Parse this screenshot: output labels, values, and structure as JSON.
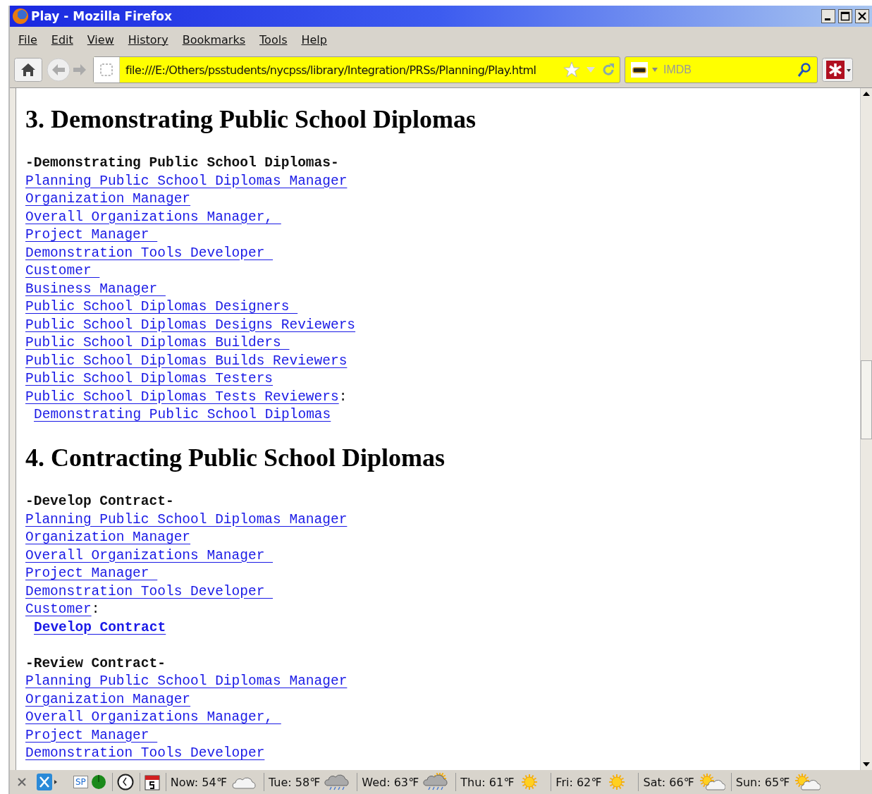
{
  "window": {
    "title": "Play - Mozilla Firefox"
  },
  "menu": [
    "File",
    "Edit",
    "View",
    "History",
    "Bookmarks",
    "Tools",
    "Help"
  ],
  "toolbar": {
    "url": "file:///E:/Others/psstudents/nycpss/library/Integration/PRSs/Planning/Play.html",
    "search_placeholder": "IMDB"
  },
  "sections": [
    {
      "heading": "3. Demonstrating Public School Diplomas",
      "blocks": [
        {
          "label": "-Demonstrating Public School Diplomas-",
          "links": [
            "Planning Public School Diplomas Manager",
            "Organization Manager",
            "Overall Organizations Manager, ",
            "Project Manager ",
            "Demonstration Tools Developer ",
            "Customer ",
            "Business Manager ",
            "Public School Diplomas Designers ",
            "Public School Diplomas Designs Reviewers",
            "Public School Diplomas Builders ",
            "Public School Diplomas Builds Reviewers",
            "Public School Diplomas Testers",
            "Public School Diplomas Tests Reviewers"
          ],
          "colon": ":",
          "action": "Demonstrating Public School Diplomas",
          "action_bold": false
        }
      ]
    },
    {
      "heading": "4. Contracting Public School Diplomas",
      "blocks": [
        {
          "label": "-Develop Contract-",
          "links": [
            "Planning Public School Diplomas Manager",
            "Organization Manager",
            "Overall Organizations Manager ",
            "Project Manager ",
            "Demonstration Tools Developer ",
            "Customer"
          ],
          "colon": ":",
          "action": "Develop Contract",
          "action_bold": true
        },
        {
          "label": "-Review Contract-",
          "links": [
            "Planning Public School Diplomas Manager",
            "Organization Manager",
            "Overall Organizations Manager, ",
            "Project Manager ",
            "Demonstration Tools Developer"
          ]
        }
      ]
    }
  ],
  "status_bar": {
    "badge": "SP",
    "weather": [
      {
        "label": "Now: 54℉",
        "kind": "cloudy"
      },
      {
        "label": "Tue: 58℉",
        "kind": "rain"
      },
      {
        "label": "Wed: 63℉",
        "kind": "sun-rain"
      },
      {
        "label": "Thu: 61℉",
        "kind": "sunny"
      },
      {
        "label": "Fri: 62℉",
        "kind": "sunny"
      },
      {
        "label": "Sat: 66℉",
        "kind": "partly-sunny"
      },
      {
        "label": "Sun: 65℉",
        "kind": "partly-sunny"
      }
    ]
  }
}
